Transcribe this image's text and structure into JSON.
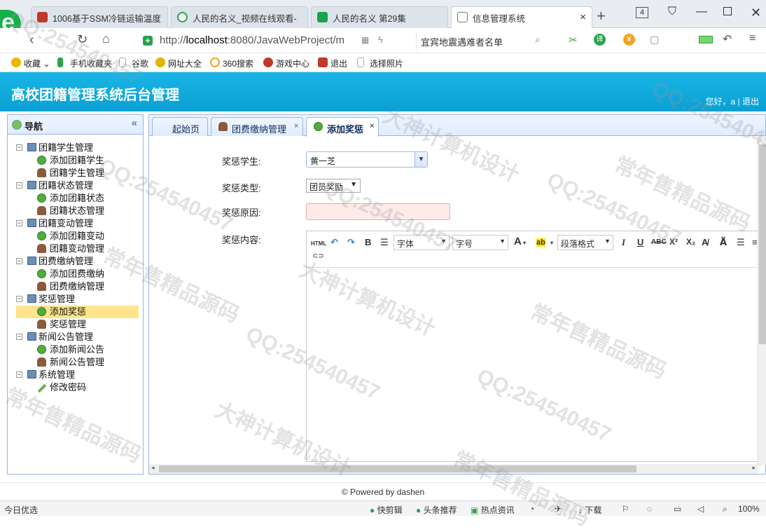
{
  "browser": {
    "tabs": [
      {
        "title": "1006基于SSM冷链运输温度",
        "color": "#c0392b"
      },
      {
        "title": "人民的名义_视频在线观看-",
        "color": "#2aa34a"
      },
      {
        "title": "人民的名义 第29集",
        "color": "#1aa34a"
      },
      {
        "title": "信息管理系统",
        "color": "#555555",
        "close": "×"
      }
    ],
    "tab_count": "4",
    "url_prefix": "http://",
    "url_host": "localhost",
    "url_rest": ":8080/JavaWebProject/m",
    "search_text": "宜宾地震遇难者名单",
    "bookmarks": [
      "收藏",
      "手机收藏夹",
      "谷歌",
      "网址大全",
      "360搜索",
      "游戏中心",
      "退出",
      "选择照片"
    ]
  },
  "app": {
    "title": "高校团籍管理系统后台管理",
    "user_greeting": "您好，a",
    "logout": "退出",
    "separator": "|"
  },
  "nav": {
    "title": "导航",
    "collapse": "«",
    "groups": [
      {
        "label": "团籍学生管理",
        "items": [
          {
            "label": "添加团籍学生",
            "icon": "add-icon"
          },
          {
            "label": "团籍学生管理",
            "icon": "user-icon"
          }
        ]
      },
      {
        "label": "团籍状态管理",
        "items": [
          {
            "label": "添加团籍状态",
            "icon": "add-icon"
          },
          {
            "label": "团籍状态管理",
            "icon": "user-icon"
          }
        ]
      },
      {
        "label": "团籍变动管理",
        "items": [
          {
            "label": "添加团籍变动",
            "icon": "add-icon"
          },
          {
            "label": "团籍变动管理",
            "icon": "user-icon"
          }
        ]
      },
      {
        "label": "团费缴纳管理",
        "items": [
          {
            "label": "添加团费缴纳",
            "icon": "add-icon"
          },
          {
            "label": "团费缴纳管理",
            "icon": "user-icon"
          }
        ]
      },
      {
        "label": "奖惩管理",
        "items": [
          {
            "label": "添加奖惩",
            "icon": "add-icon",
            "selected": true
          },
          {
            "label": "奖惩管理",
            "icon": "user-icon"
          }
        ]
      },
      {
        "label": "新闻公告管理",
        "items": [
          {
            "label": "添加新闻公告",
            "icon": "add-icon"
          },
          {
            "label": "新闻公告管理",
            "icon": "user-icon"
          }
        ]
      },
      {
        "label": "系统管理",
        "items": [
          {
            "label": "修改密码",
            "icon": "pencil-icon"
          }
        ]
      }
    ]
  },
  "content_tabs": [
    {
      "label": "起始页"
    },
    {
      "label": "团费缴纳管理",
      "close": "×"
    },
    {
      "label": "添加奖惩",
      "close": "×",
      "active": true
    }
  ],
  "form": {
    "student_label": "奖惩学生:",
    "student_value": "黄一芝",
    "type_label": "奖惩类型:",
    "type_value": "团员奖励",
    "reason_label": "奖惩原因:",
    "reason_value": "",
    "content_label": "奖惩内容:"
  },
  "editor_toolbar": {
    "html": "HTML",
    "bold": "B",
    "font_family": "字体",
    "font_size": "字号",
    "font_color": "A",
    "highlight": "ab",
    "paragraph": "段落格式",
    "italic": "I",
    "underline": "U",
    "strike": "ABC",
    "superscript": "X²",
    "subscript": "X₂"
  },
  "footer": {
    "text": "© Powered by dashen"
  },
  "statusbar": {
    "left": "今日优选",
    "items": [
      "快剪辑",
      "头条推荐",
      "热点资讯",
      "下载"
    ],
    "zoom": "100%"
  },
  "watermarks": [
    "QQ:254540457",
    "大神计算机设计",
    "常年售精品源码"
  ],
  "colors": {
    "header": "#0a9fd4",
    "nav_border": "#95b8e7",
    "selected": "#ffe48d",
    "reason_bg": "#ffeaea"
  }
}
